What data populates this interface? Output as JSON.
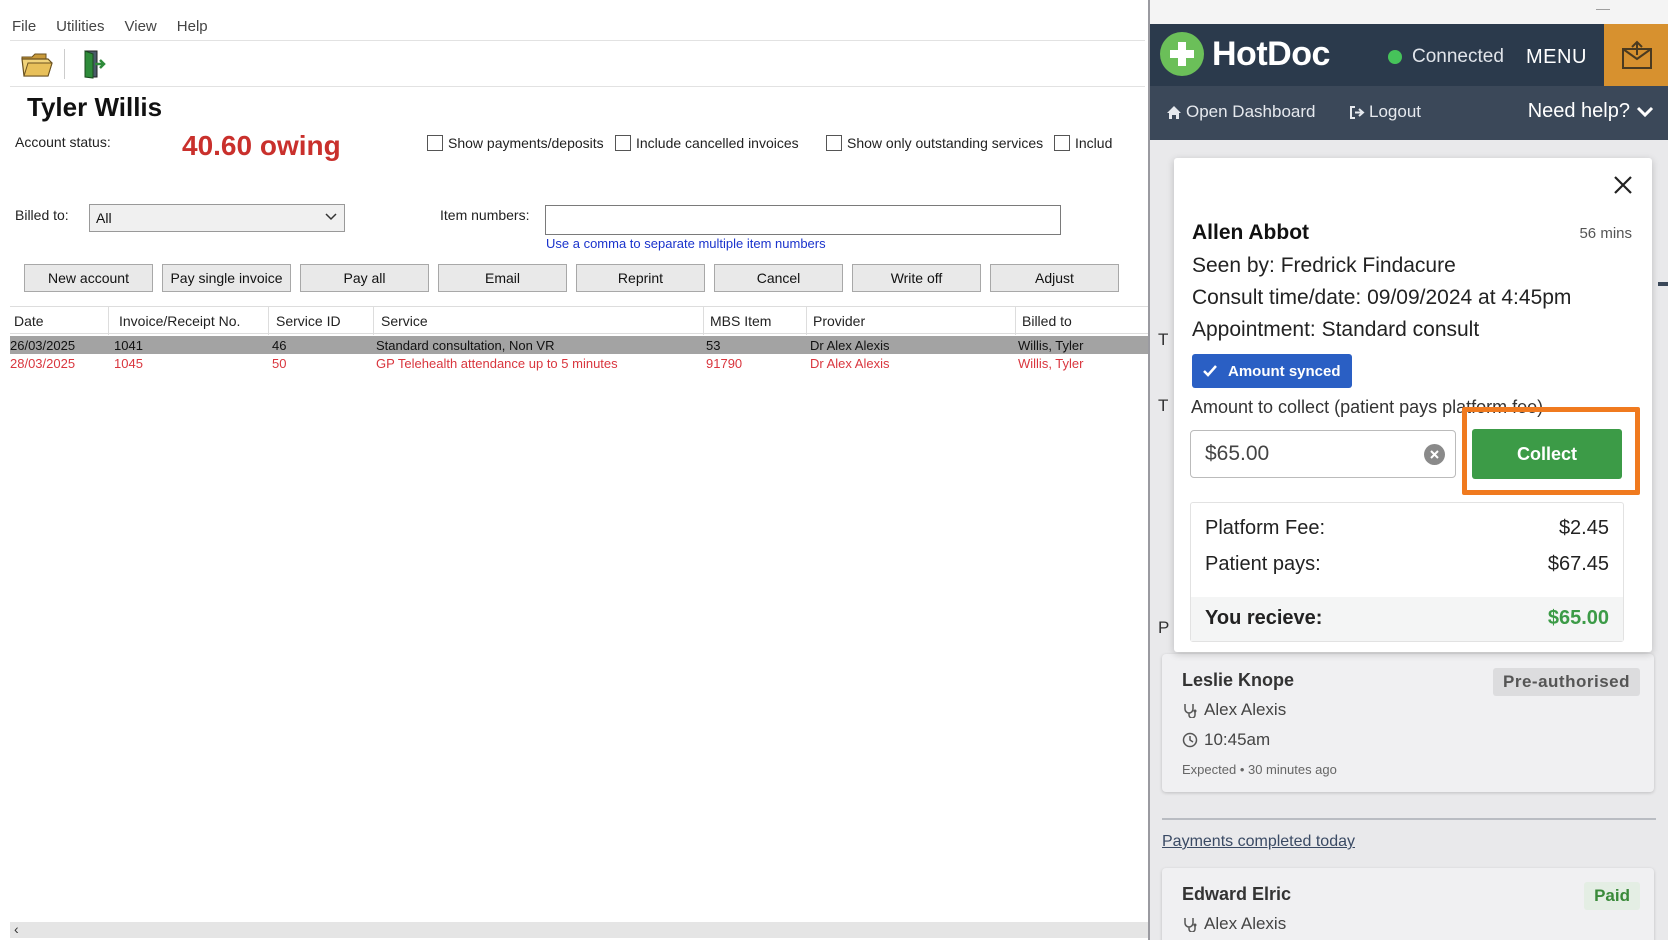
{
  "menu": [
    "File",
    "Utilities",
    "View",
    "Help"
  ],
  "toolbar": {
    "open_icon": "folder-open-icon",
    "exit_icon": "exit-door-icon"
  },
  "patient": {
    "name": "Tyler Willis",
    "account_status_label": "Account status:",
    "account_status_value": "40.60 owing"
  },
  "filters": {
    "show_payments": "Show payments/deposits",
    "include_cancelled": "Include cancelled invoices",
    "show_outstanding": "Show only outstanding services",
    "include_partial": "Includ"
  },
  "billed_to": {
    "label": "Billed to:",
    "value": "All"
  },
  "item_numbers": {
    "label": "Item numbers:",
    "value": "",
    "hint": "Use a comma to separate multiple item numbers"
  },
  "actions": [
    "New account",
    "Pay single invoice",
    "Pay all",
    "Email",
    "Reprint",
    "Cancel",
    "Write off",
    "Adjust"
  ],
  "table": {
    "columns": [
      "Date",
      "Invoice/Receipt No.",
      "Service ID",
      "Service",
      "MBS Item",
      "Provider",
      "Billed to"
    ],
    "rows": [
      {
        "date": "26/03/2025",
        "invoice": "1041",
        "service_id": "46",
        "service": "Standard consultation, Non VR",
        "mbs": "53",
        "provider": "Dr Alex Alexis",
        "billed_to": "Willis, Tyler"
      },
      {
        "date": "28/03/2025",
        "invoice": "1045",
        "service_id": "50",
        "service": "GP Telehealth attendance up to 5 minutes",
        "mbs": "91790",
        "provider": "Dr Alex Alexis",
        "billed_to": "Willis, Tyler"
      }
    ]
  },
  "hotdoc": {
    "brand": "HotDoc",
    "status": "Connected",
    "menu": "MENU",
    "nav": {
      "dashboard": "Open Dashboard",
      "logout": "Logout",
      "help": "Need help?"
    },
    "bg_letters": [
      "T",
      "T",
      "P"
    ],
    "modal": {
      "patient": "Allen Abbot",
      "elapsed": "56 mins",
      "seen_by": "Seen by: Fredrick Findacure",
      "consult": "Consult time/date: 09/09/2024 at 4:45pm",
      "appointment": "Appointment: Standard consult",
      "synced": "Amount synced",
      "collect_label": "Amount to collect (patient pays platform fee)",
      "amount": "$65.00",
      "collect_button": "Collect",
      "platform_fee_label": "Platform Fee:",
      "platform_fee": "$2.45",
      "patient_pays_label": "Patient pays:",
      "patient_pays": "$67.45",
      "receive_label": "You recieve:",
      "receive": "$65.00"
    },
    "card1": {
      "name": "Leslie Knope",
      "badge": "Pre-authorised",
      "doctor": "Alex Alexis",
      "time": "10:45am",
      "meta": "Expected • 30 minutes ago"
    },
    "completed_link": "Payments completed today",
    "card2": {
      "name": "Edward Elric",
      "badge": "Paid",
      "doctor": "Alex Alexis"
    }
  }
}
